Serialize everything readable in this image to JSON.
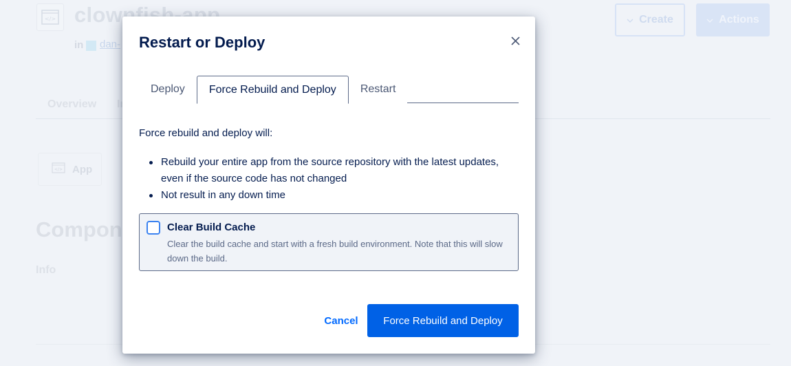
{
  "background": {
    "app_title": "clownfish-app",
    "in_label": "in",
    "team_link": "dan-",
    "create_button": "Create",
    "actions_button": "Actions",
    "tabs": [
      "Overview",
      "In"
    ],
    "app_card_label": "App",
    "components_heading": "Components",
    "info_label": "Info"
  },
  "modal": {
    "title": "Restart or Deploy",
    "close_icon": "close-icon",
    "tabs": [
      {
        "label": "Deploy",
        "active": false
      },
      {
        "label": "Force Rebuild and Deploy",
        "active": true
      },
      {
        "label": "Restart",
        "active": false
      }
    ],
    "intro": "Force rebuild and deploy will:",
    "bullets": [
      "Rebuild your entire app from the source repository with the latest updates, even if the source code has not changed",
      "Not result in any down time"
    ],
    "clear_cache": {
      "checked": false,
      "label": "Clear Build Cache",
      "description": "Clear the build cache and start with a fresh build environment. Note that this will slow down the build."
    },
    "cancel_label": "Cancel",
    "confirm_label": "Force Rebuild and Deploy"
  },
  "colors": {
    "primary": "#0061e6",
    "link": "#0069ff",
    "heading": "#031b4e",
    "checkbox_border": "#3b82f0"
  }
}
